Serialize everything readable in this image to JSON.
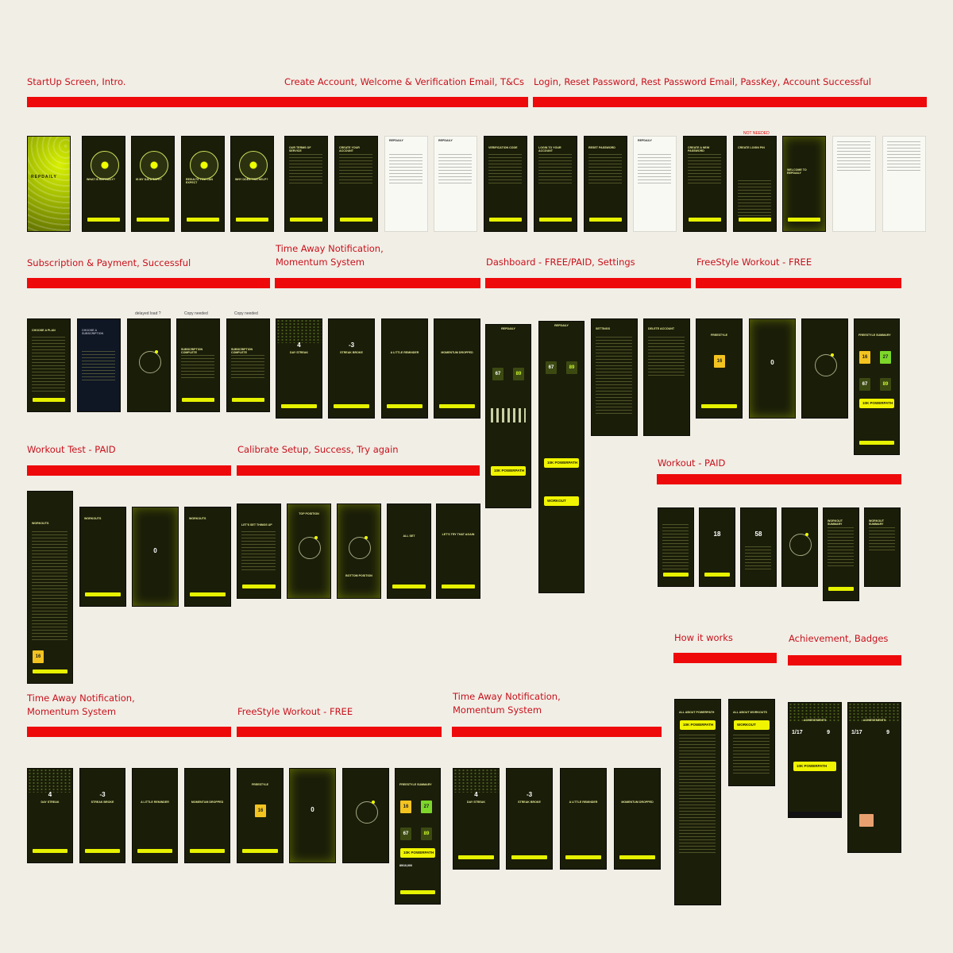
{
  "sections": {
    "startup": "StartUp Screen, Intro.",
    "create_account": "Create Account, Welcome & Verification Email, T&Cs",
    "login": "Login, Reset Password, Rest Password Email, PassKey, Account Successful",
    "subscription": "Subscription & Payment, Successful",
    "time_away_1": "Time Away Notification,\nMomentum System",
    "dashboard": "Dashboard - FREE/PAID, Settings",
    "freestyle_1": "FreeStyle Workout - FREE",
    "workout_test": "Workout Test - PAID",
    "calibrate": "Calibrate Setup, Success, Try again",
    "workout_paid": "Workout - PAID",
    "how_it_works": "How it works",
    "achievement": "Achievement, Badges",
    "time_away_2": "Time Away Notification,\nMomentum System",
    "freestyle_2": "FreeStyle Workout - FREE",
    "time_away_3": "Time Away Notification,\nMomentum System"
  },
  "notes": {
    "not_needed": "NOT NEEDED",
    "delayed_load": "delayed load ?",
    "copy_needed_1": "Copy needed",
    "copy_needed_2": "Copy needed"
  },
  "screens": {
    "splash_logo": "REPDAILY",
    "intro_1": "WHAT IS REPDAILY?",
    "intro_2": "IS MY DATA SAFE?",
    "intro_3": "RESULTS YOU CAN EXPECT",
    "intro_4": "WHY DOES THIS HELP?",
    "terms": "OUR TERMS OF SERVICE",
    "create": "CREATE YOUR ACCOUNT",
    "email_1": "REPDAILY",
    "email_2": "REPDAILY",
    "verification": "VERIFICATION CODE",
    "login": "LOGIN TO YOUR ACCOUNT",
    "reset": "RESET PASSWORD",
    "email_reset": "REPDAILY",
    "new_password": "CREATE A NEW PASSWORD",
    "login_pin": "CREATE LOGIN PIN",
    "welcome": "WELCOME TO REPDAILY",
    "plan": "CHOOSE A PLAN",
    "payment": "CHOOSE A SUBSCRIPTION",
    "sub_complete": "SUBSCRIPTION COMPLETE",
    "sub_complete_2": "SUBSCRIPTION COMPLETE",
    "streak_day": "4",
    "streak_day_label": "DAY STREAK",
    "streak_broke": "-3",
    "streak_broke_label": "STREAK BROKE",
    "reminder": "A LITTLE REMINDER",
    "momentum_dropped": "MOMENTUM DROPPED",
    "dash_free": "REPDAILY",
    "dash_paid": "REPDAILY",
    "settings": "SETTINGS",
    "delete": "DELETE ACCOUNT",
    "freestyle": "FREESTYLE",
    "freestyle_num": "16",
    "countdown": "0",
    "freestyle_summary": "FREESTYLE SUMMARY",
    "tile_16": "16",
    "tile_27": "27",
    "tile_67": "67",
    "tile_89": "89",
    "powerpath": "10K POWERPATH",
    "powerpath_count": "89/10,000",
    "workouts": "WORKOUTS",
    "progression": "PROGRESSION",
    "lets_set_up": "LET'S SET THINGS UP",
    "top_position": "TOP POSITION",
    "bottom_position": "BOTTOM POSITION",
    "all_set": "ALL SET",
    "try_again": "LET'S TRY THAT AGAIN",
    "set_num": "18",
    "rest_num": "58",
    "workout_summary": "WORKOUT SUMMARY",
    "all_about_powerpath": "ALL ABOUT POWERPATH",
    "all_about_workouts": "ALL ABOUT WORKOUTS",
    "achievements": "ACHIEVEMENTS",
    "ach_count": "1/17",
    "ach_num": "9",
    "workout_progression": "WORKOUT PROGRESSION"
  }
}
